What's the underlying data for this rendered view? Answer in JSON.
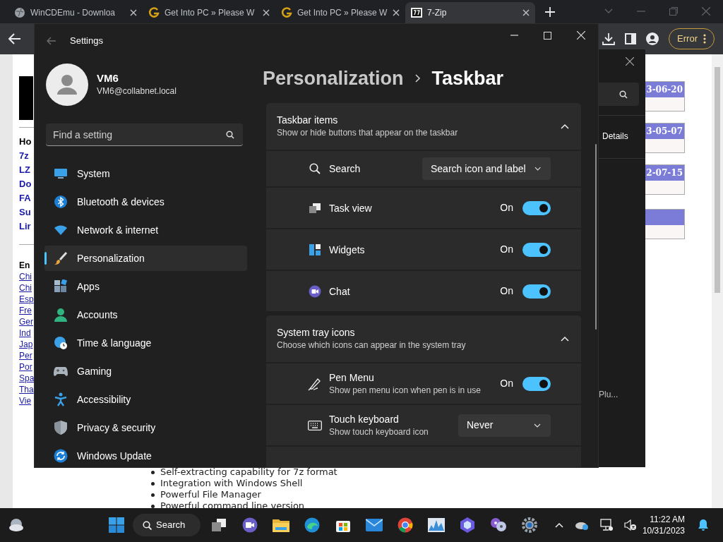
{
  "browser": {
    "tabs": [
      {
        "title": "WinCDEmu - Downloa",
        "selected": false
      },
      {
        "title": "Get Into PC » Please W",
        "selected": false
      },
      {
        "title": "Get Into PC » Please W",
        "selected": false
      },
      {
        "title": "7-Zip",
        "selected": true
      }
    ],
    "profile_button": "Error"
  },
  "web_page": {
    "nav_heading": "Ho",
    "nav_links": [
      "7z",
      "LZ",
      "Do",
      "FA",
      "Su",
      "Lir"
    ],
    "lang_heading": "En",
    "lang_links": [
      "Chi",
      "Chi",
      "Esp",
      "Fre",
      "Ger",
      "Ind",
      "Jap",
      "Per",
      "Por",
      "Spa",
      "Tha",
      "Vie"
    ],
    "news_dates": [
      "3-06-20",
      "3-05-07",
      "2-07-15"
    ],
    "features": [
      "Self-extracting capability for 7z format",
      "Integration with Windows Shell",
      "Powerful File Manager",
      "Powerful command line version"
    ]
  },
  "background_window": {
    "button": "Details",
    "item": "Plu..."
  },
  "settings": {
    "title": "Settings",
    "user": {
      "name": "VM6",
      "email": "VM6@collabnet.local"
    },
    "search": {
      "placeholder": "Find a setting"
    },
    "nav": [
      {
        "label": "System",
        "selected": false
      },
      {
        "label": "Bluetooth & devices",
        "selected": false
      },
      {
        "label": "Network & internet",
        "selected": false
      },
      {
        "label": "Personalization",
        "selected": true
      },
      {
        "label": "Apps",
        "selected": false
      },
      {
        "label": "Accounts",
        "selected": false
      },
      {
        "label": "Time & language",
        "selected": false
      },
      {
        "label": "Gaming",
        "selected": false
      },
      {
        "label": "Accessibility",
        "selected": false
      },
      {
        "label": "Privacy & security",
        "selected": false
      },
      {
        "label": "Windows Update",
        "selected": false
      }
    ],
    "breadcrumb": [
      "Personalization",
      "Taskbar"
    ],
    "sections": [
      {
        "title": "Taskbar items",
        "subtitle": "Show or hide buttons that appear on the taskbar",
        "expanded": true,
        "items": [
          {
            "kind": "dropdown",
            "label": "Search",
            "value": "Search icon and label"
          },
          {
            "kind": "toggle",
            "label": "Task view",
            "state_text": "On",
            "on": true
          },
          {
            "kind": "toggle",
            "label": "Widgets",
            "state_text": "On",
            "on": true
          },
          {
            "kind": "toggle",
            "label": "Chat",
            "state_text": "On",
            "on": true
          }
        ]
      },
      {
        "title": "System tray icons",
        "subtitle": "Choose which icons can appear in the system tray",
        "expanded": true,
        "items": [
          {
            "kind": "toggle",
            "label": "Pen Menu",
            "description": "Show pen menu icon when pen is in use",
            "state_text": "On",
            "on": true
          },
          {
            "kind": "dropdown",
            "label": "Touch keyboard",
            "description": "Show touch keyboard icon",
            "value": "Never"
          }
        ]
      }
    ]
  },
  "taskbar": {
    "search_label": "Search",
    "time": "11:22 AM",
    "date": "10/31/2023"
  }
}
